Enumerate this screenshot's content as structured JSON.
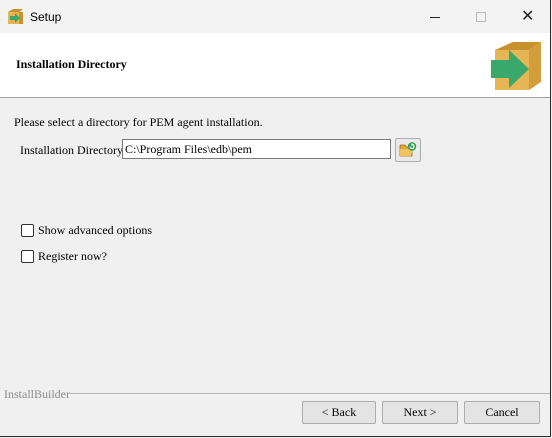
{
  "window": {
    "title": "Setup",
    "controls": [
      "minimize",
      "maximize",
      "close"
    ]
  },
  "header": {
    "title": "Installation Directory",
    "logo_icon": "installer-box-arrow-icon"
  },
  "main": {
    "prompt": "Please select a directory for PEM agent installation.",
    "directory_label": "Installation Directory",
    "directory_value": "C:\\Program Files\\edb\\pem",
    "browse_icon": "folder-browse-icon",
    "options": [
      {
        "label": "Show advanced options",
        "checked": false
      },
      {
        "label": "Register now?",
        "checked": false
      }
    ]
  },
  "footer": {
    "brand": "InstallBuilder",
    "back_label": "< Back",
    "next_label": "Next >",
    "cancel_label": "Cancel"
  },
  "colors": {
    "accent_green": "#3ba86b",
    "box_tan": "#e6b656"
  }
}
